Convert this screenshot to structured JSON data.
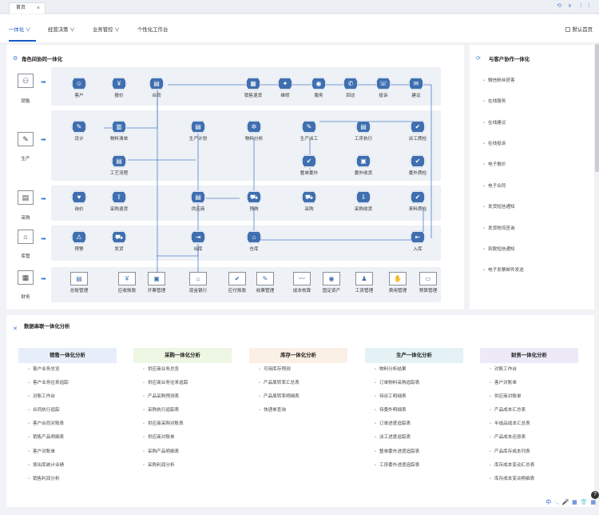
{
  "tabbar": {
    "tab": "首页",
    "close": "×",
    "controls": "⟲ ∨ ⋮⋮"
  },
  "nav": {
    "items": [
      "一体化 ∨",
      "经营决策 ∨",
      "业务管控 ∨",
      "个性化工作台"
    ],
    "default_home": "默认首页"
  },
  "left_panel": {
    "title": "角色间协同一体化",
    "roles": [
      "销售",
      "生产",
      "采购",
      "库管",
      "财务"
    ],
    "sales": [
      "客户",
      "报价",
      "合同",
      "销售退货",
      "维修",
      "服务",
      "回访",
      "投诉",
      "建议"
    ],
    "production": [
      "设计",
      "物料清单",
      "生产计划",
      "物料分析",
      "生产派工",
      "工序执行",
      "派工质检",
      "工艺流程",
      "整单委外",
      "委外收货",
      "委外质检"
    ],
    "purchase": [
      "询价",
      "采购退货",
      "供应商",
      "预购",
      "采购",
      "采购收货",
      "来料质检"
    ],
    "inventory": [
      "预警",
      "发货",
      "出库",
      "仓库",
      "入库"
    ],
    "finance": [
      "总账管理",
      "应收账款",
      "开票管理",
      "现金银行",
      "应付账款",
      "收票管理",
      "成本核算",
      "固定资产",
      "工资管理",
      "费用管理",
      "预算管理"
    ]
  },
  "right_panel": {
    "title": "与客户协作一体化",
    "items": [
      "微信粉丝获客",
      "在线服务",
      "在线建议",
      "在线投诉",
      "电子报价",
      "电子合同",
      "发货短信通知",
      "发货物流查询",
      "到款短信通知",
      "电子发票邮件发送"
    ]
  },
  "bottom": {
    "title": "数据串联一体化分析",
    "columns": [
      {
        "title": "销售一体化分析",
        "items": [
          "客户业务总览",
          "客户业务往来追踪",
          "对账工作台",
          "合同执行追踪",
          "客户合同对账表",
          "销售产品明细表",
          "客户对账单",
          "按出库统计业绩",
          "销售利润分析"
        ]
      },
      {
        "title": "采购一体化分析",
        "items": [
          "供应商业务总览",
          "供应商业务往来追踪",
          "产品采购预测表",
          "采购执行追踪表",
          "供应商采购对账表",
          "供应商对账单",
          "采购产品明细表",
          "采购利润分析"
        ]
      },
      {
        "title": "库存一体化分析",
        "items": [
          "可用库存预测",
          "产品周转率汇总表",
          "产品周转率明细表",
          "快递单查询"
        ]
      },
      {
        "title": "生产一体化分析",
        "items": [
          "物料分析结果",
          "订单物料采购追踪表",
          "待派工明细表",
          "待委外明细表",
          "订单进度追踪表",
          "派工进度追踪表",
          "整单委外进度追踪表",
          "工序委外进度追踪表"
        ]
      },
      {
        "title": "财务一体化分析",
        "items": [
          "对账工作台",
          "客户对账单",
          "供应商对账单",
          "产品成本汇总表",
          "半成品成本汇总表",
          "产品成本还原表",
          "产品库存成本列表",
          "库存成本变动汇总表",
          "库存成本变动明细表"
        ]
      }
    ],
    "colors": [
      "#e6eef9",
      "#eef6e4",
      "#fbf0e6",
      "#e4f2f6",
      "#ede9f7"
    ]
  },
  "tray": "中 ·, 🎤 ▦ 👕 ▦",
  "help": "?"
}
